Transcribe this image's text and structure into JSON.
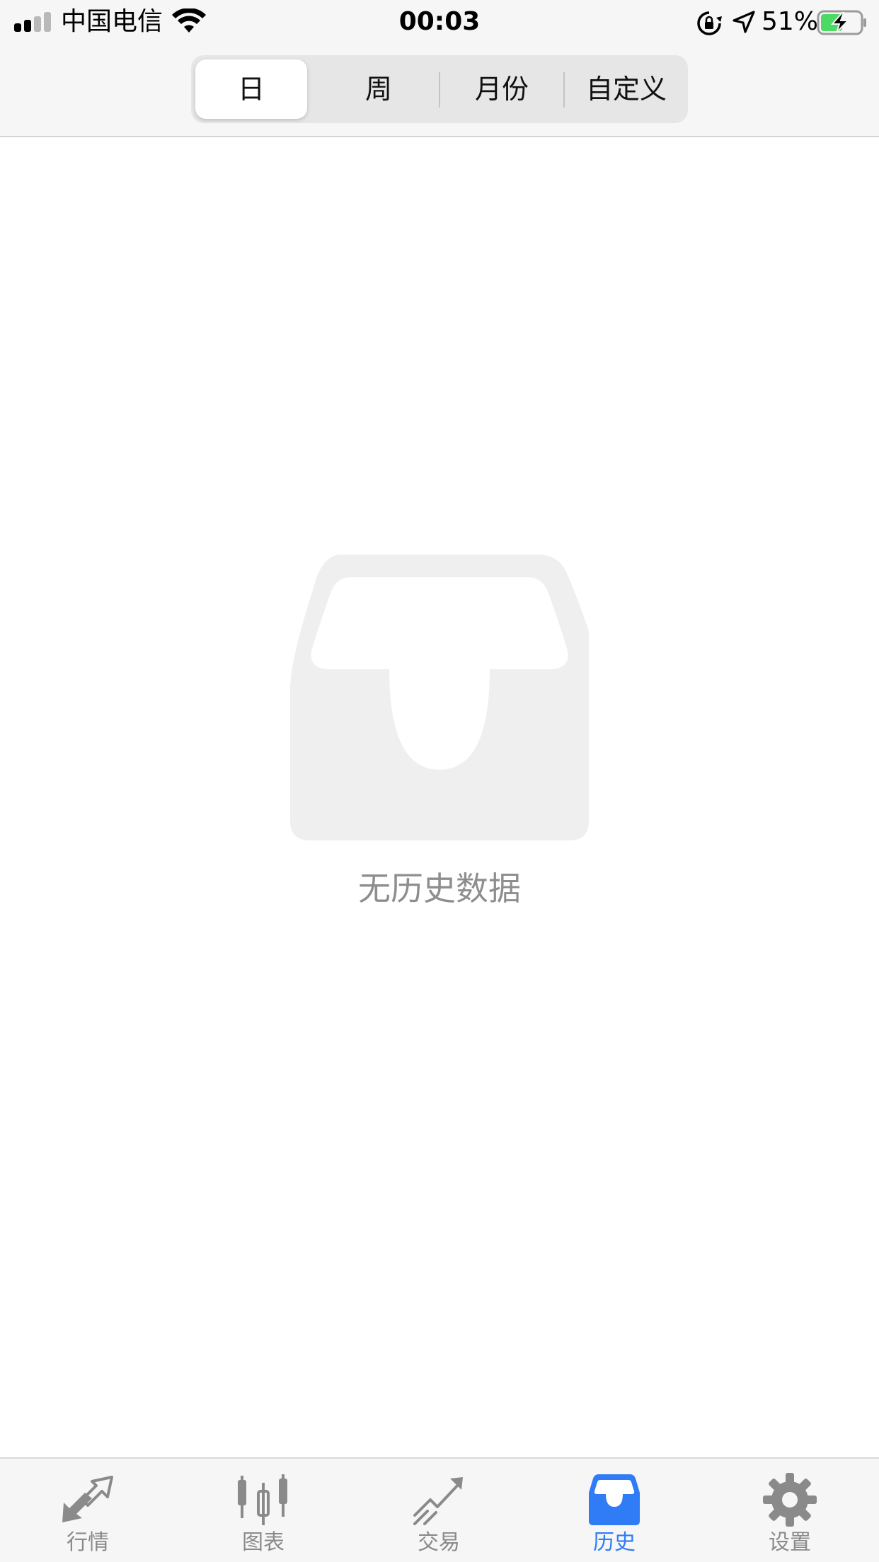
{
  "status_bar": {
    "carrier": "中国电信",
    "time": "00:03",
    "battery_percent": "51%",
    "signal_bars_active": 2,
    "signal_bars_total": 4,
    "icons": [
      "signal-icon",
      "wifi-icon",
      "rotation-lock-icon",
      "location-arrow-icon",
      "battery-charging-icon"
    ]
  },
  "segmented_control": {
    "selected_index": 0,
    "segments": [
      {
        "label": "日"
      },
      {
        "label": "周"
      },
      {
        "label": "月份"
      },
      {
        "label": "自定义"
      }
    ]
  },
  "empty_state": {
    "icon": "empty-tray-icon",
    "message": "无历史数据"
  },
  "tab_bar": {
    "active_index": 3,
    "tabs": [
      {
        "label": "行情",
        "icon": "quotes-arrows-icon"
      },
      {
        "label": "图表",
        "icon": "candlestick-chart-icon"
      },
      {
        "label": "交易",
        "icon": "trade-trend-icon"
      },
      {
        "label": "历史",
        "icon": "history-tray-icon"
      },
      {
        "label": "设置",
        "icon": "settings-gear-icon"
      }
    ]
  },
  "colors": {
    "accent": "#2f7cf6",
    "inactive": "#8a8a8a",
    "battery_fill": "#4cd964",
    "bar_background": "#f6f6f6",
    "empty_icon": "#efefef",
    "empty_text": "#8e8e8e"
  }
}
